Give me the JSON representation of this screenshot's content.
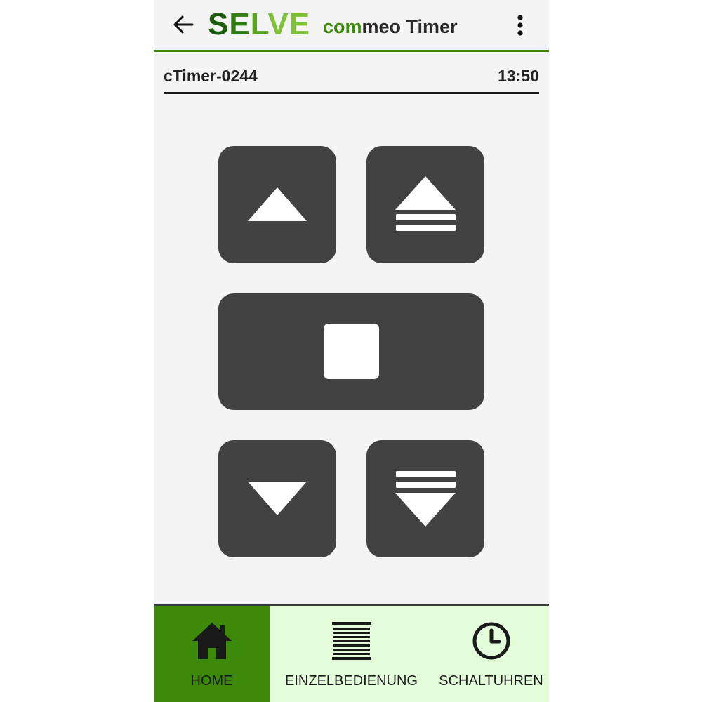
{
  "header": {
    "back_icon": "arrow-left-icon",
    "brand_letters": [
      "S",
      "E",
      "L",
      "V",
      "E"
    ],
    "title_prefix": "com",
    "title_suffix": "meo Timer",
    "menu_icon": "more-vert-icon"
  },
  "device": {
    "name": "cTimer-0244",
    "time": "13:50"
  },
  "controls": {
    "up_icon": "triangle-up-icon",
    "up_full_icon": "triangle-up-lines-icon",
    "stop_icon": "square-stop-icon",
    "down_icon": "triangle-down-icon",
    "down_full_icon": "lines-triangle-down-icon"
  },
  "nav": {
    "home_label": "HOME",
    "single_label": "EINZELBEDIENUNG",
    "timers_label": "SCHALTUHREN",
    "home_icon": "house-icon",
    "single_icon": "blinds-icon",
    "timers_icon": "clock-icon"
  },
  "colors": {
    "accent_green": "#3d8a0b",
    "button_dark": "#424242",
    "nav_background": "#e3fcd9",
    "page_background": "#f4f4f4"
  }
}
